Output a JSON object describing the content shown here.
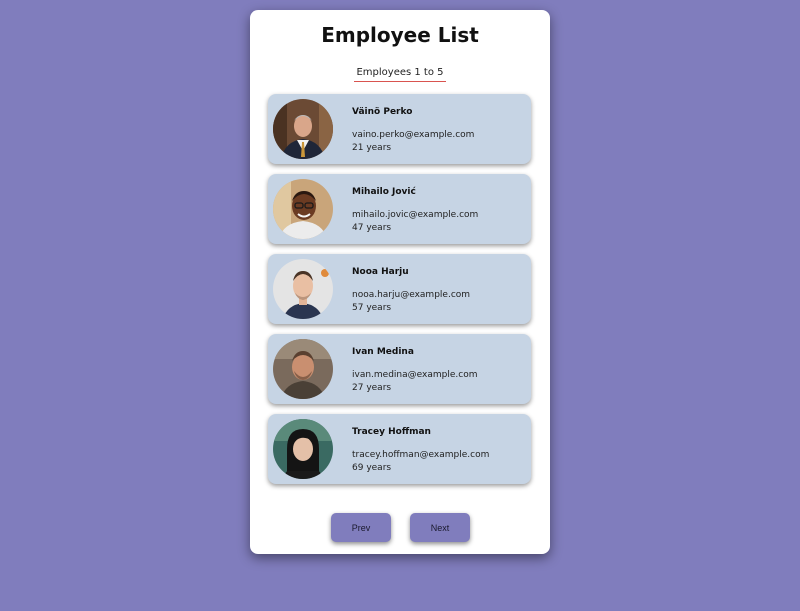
{
  "header": {
    "title": "Employee List",
    "subtitle": "Employees 1 to 5"
  },
  "employees": [
    {
      "name": "Väinö Perko",
      "email": "vaino.perko@example.com",
      "age": "21 years"
    },
    {
      "name": "Mihailo Jović",
      "email": "mihailo.jovic@example.com",
      "age": "47 years"
    },
    {
      "name": "Nooa Harju",
      "email": "nooa.harju@example.com",
      "age": "57 years"
    },
    {
      "name": "Ivan Medina",
      "email": "ivan.medina@example.com",
      "age": "27 years"
    },
    {
      "name": "Tracey Hoffman",
      "email": "tracey.hoffman@example.com",
      "age": "69 years"
    }
  ],
  "pagination": {
    "prev_label": "Prev",
    "next_label": "Next"
  },
  "colors": {
    "background": "#807dbd",
    "card": "#ffffff",
    "employee_card": "#c6d4e4",
    "underline": "#d9534f",
    "button": "#807dbd"
  }
}
